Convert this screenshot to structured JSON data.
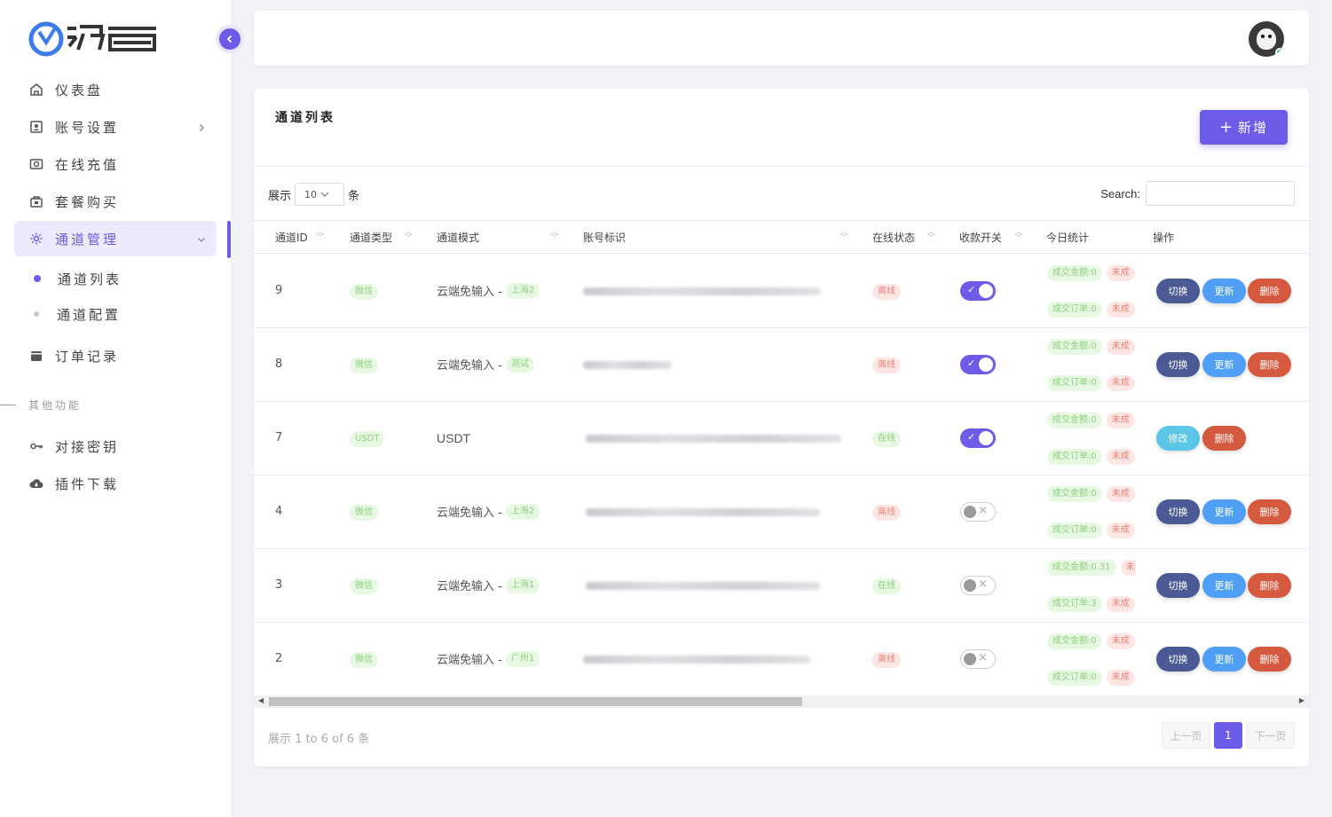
{
  "sidebar": {
    "logo_text": "源力富",
    "menu": [
      {
        "label": "仪表盘",
        "icon": "home-icon"
      },
      {
        "label": "账号设置",
        "icon": "id-card-icon",
        "has_children": true
      },
      {
        "label": "在线充值",
        "icon": "camera-icon"
      },
      {
        "label": "套餐购买",
        "icon": "bag-icon"
      },
      {
        "label": "通道管理",
        "icon": "gear-icon",
        "active": true
      }
    ],
    "submenu": [
      {
        "label": "通道列表",
        "current": true
      },
      {
        "label": "通道配置",
        "current": false
      }
    ],
    "orders_label": "订单记录",
    "section_label": "其他功能",
    "extra": [
      {
        "label": "对接密钥",
        "icon": "key-icon"
      },
      {
        "label": "插件下载",
        "icon": "cloud-download-icon"
      }
    ]
  },
  "page": {
    "title": "通道列表",
    "add_button": "新增",
    "add_icon": "+",
    "show_prefix": "展示",
    "page_size": "10",
    "show_suffix": "条",
    "search_label": "Search:"
  },
  "table": {
    "headers": [
      "通道ID",
      "通道类型",
      "通道模式",
      "账号标识",
      "在线状态",
      "收款开关",
      "今日统计",
      "操作"
    ],
    "rows": [
      {
        "id": "9",
        "type": "微信",
        "mode": "云端免输入 -",
        "mode_tag": "上海2",
        "status": "离线",
        "status_ok": false,
        "enabled": true,
        "amount": "成交金额:0",
        "amount_tail": "未成",
        "orders": "成交订单:0",
        "orders_tail": "未成",
        "actions": [
          "切换",
          "更新",
          "删除"
        ]
      },
      {
        "id": "8",
        "type": "微信",
        "mode": "云端免输入 -",
        "mode_tag": "测试",
        "status": "离线",
        "status_ok": false,
        "enabled": true,
        "amount": "成交金额:0",
        "amount_tail": "未成",
        "orders": "成交订单:0",
        "orders_tail": "未成",
        "actions": [
          "切换",
          "更新",
          "删除"
        ]
      },
      {
        "id": "7",
        "type": "USDT",
        "mode": "USDT",
        "mode_tag": "",
        "status": "在线",
        "status_ok": true,
        "enabled": true,
        "amount": "成交金额:0",
        "amount_tail": "未成",
        "orders": "成交订单:0",
        "orders_tail": "未成",
        "actions": [
          "修改",
          "删除"
        ]
      },
      {
        "id": "4",
        "type": "微信",
        "mode": "云端免输入 -",
        "mode_tag": "上海2",
        "status": "离线",
        "status_ok": false,
        "enabled": false,
        "amount": "成交金额:0",
        "amount_tail": "未成",
        "orders": "成交订单:0",
        "orders_tail": "未成",
        "actions": [
          "切换",
          "更新",
          "删除"
        ]
      },
      {
        "id": "3",
        "type": "微信",
        "mode": "云端免输入 -",
        "mode_tag": "上海1",
        "status": "在线",
        "status_ok": true,
        "enabled": false,
        "amount": "成交金额:0.31",
        "amount_tail": "未",
        "orders": "成交订单:3",
        "orders_tail": "未成",
        "actions": [
          "切换",
          "更新",
          "删除"
        ]
      },
      {
        "id": "2",
        "type": "微信",
        "mode": "云端免输入 -",
        "mode_tag": "广州1",
        "status": "离线",
        "status_ok": false,
        "enabled": false,
        "amount": "成交金额:0",
        "amount_tail": "未成",
        "orders": "成交订单:0",
        "orders_tail": "未成",
        "actions": [
          "切换",
          "更新",
          "删除"
        ]
      }
    ]
  },
  "footer": {
    "info": "展示 1 to 6 of 6 条",
    "prev": "上一页",
    "current_page": "1",
    "next": "下一页"
  },
  "colors": {
    "accent": "#6c5ce7",
    "switch_btn": "#4b5a94",
    "update_btn": "#4e9ff5",
    "delete_btn": "#d4593f",
    "edit_btn": "#5bc6e8"
  }
}
